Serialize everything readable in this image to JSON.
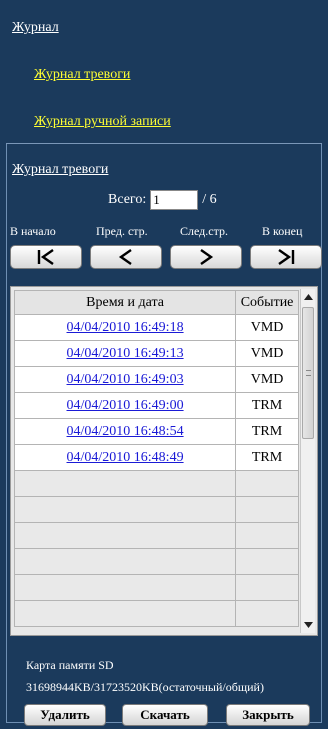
{
  "top": {
    "section_title": "Журнал",
    "links": [
      "Журнал тревоги",
      "Журнал ручной записи"
    ]
  },
  "log": {
    "title": "Журнал тревоги",
    "total_label": "Всего:",
    "current_page": "1",
    "total_pages": "/ 6"
  },
  "pager": {
    "first_label": "В начало",
    "prev_label": "Пред. стр.",
    "next_label": "След.стр.",
    "last_label": "В конец"
  },
  "table": {
    "headers": [
      "Время и дата",
      "Событие"
    ],
    "rows": [
      {
        "datetime": "04/04/2010 16:49:18",
        "event": "VMD"
      },
      {
        "datetime": "04/04/2010 16:49:13",
        "event": "VMD"
      },
      {
        "datetime": "04/04/2010 16:49:03",
        "event": "VMD"
      },
      {
        "datetime": "04/04/2010 16:49:00",
        "event": "TRM"
      },
      {
        "datetime": "04/04/2010 16:48:54",
        "event": "TRM"
      },
      {
        "datetime": "04/04/2010 16:48:49",
        "event": "TRM"
      }
    ]
  },
  "sd": {
    "label": "Карта памяти SD",
    "value": "31698944KB/31723520KB(остаточный/общий)"
  },
  "buttons": {
    "delete": "Удалить",
    "download": "Скачать",
    "close": "Закрыть"
  },
  "colors": {
    "background": "#1b3a5c",
    "link_yellow": "#ffff33",
    "table_link": "#1a1ad6"
  }
}
